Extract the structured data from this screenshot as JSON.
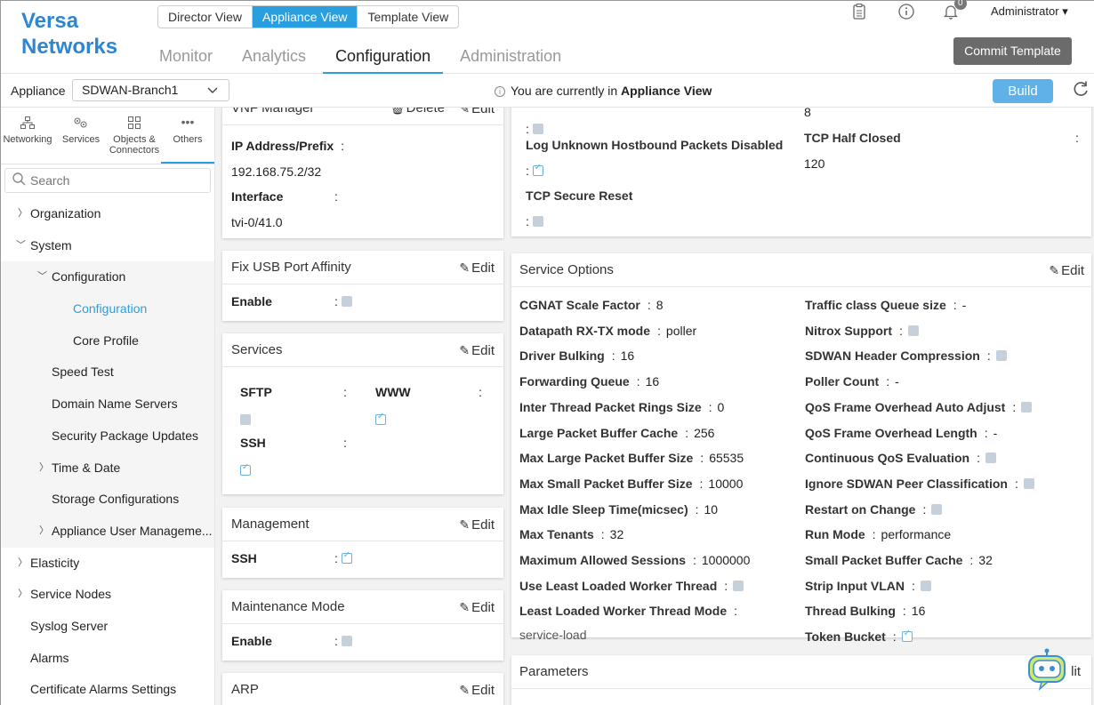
{
  "header": {
    "logo_line1": "Versa",
    "logo_line2": "Networks",
    "view_switch": [
      "Director View",
      "Appliance View",
      "Template View"
    ],
    "tabs": [
      "Monitor",
      "Analytics",
      "Configuration",
      "Administration"
    ],
    "notification_count": "0",
    "user": "Administrator",
    "commit_button": "Commit Template"
  },
  "subbar": {
    "appliance_label": "Appliance",
    "appliance_value": "SDWAN-Branch1",
    "current_view_prefix": "You are currently in",
    "current_view_value": "Appliance View",
    "build_button": "Build"
  },
  "sidebar": {
    "categories": [
      "Networking",
      "Services",
      "Objects &",
      "Connectors",
      "Others"
    ],
    "search_placeholder": "Search",
    "items": [
      "Organization",
      "System",
      "Configuration",
      "Configuration",
      "Core Profile",
      "Speed Test",
      "Domain Name Servers",
      "Security Package Updates",
      "Time & Date",
      "Storage Configurations",
      "Appliance User Manageme...",
      "Elasticity",
      "Service Nodes",
      "Syslog Server",
      "Alarms",
      "Certificate Alarms Settings"
    ]
  },
  "mid": {
    "edit": "Edit",
    "delete": "Delete",
    "vnf": {
      "title": "VNF Manager",
      "ip_label": "IP Address/Prefix",
      "ip_value": "192.168.75.2/32",
      "iface_label": "Interface",
      "iface_value": "tvi-0/41.0"
    },
    "usb": {
      "title": "Fix USB Port Affinity",
      "enable_label": "Enable"
    },
    "services": {
      "title": "Services",
      "sftp": "SFTP",
      "www": "WWW",
      "ssh": "SSH"
    },
    "management": {
      "title": "Management",
      "ssh": "SSH"
    },
    "maintenance": {
      "title": "Maintenance Mode",
      "enable_label": "Enable"
    },
    "arp": {
      "title": "ARP"
    }
  },
  "right": {
    "top": {
      "log_unknown": "Log Unknown Hostbound Packets Disabled",
      "tcp_secure_reset": "TCP Secure Reset",
      "val_8": "8",
      "tcp_half_closed": "TCP Half Closed",
      "val_120": "120"
    },
    "service_options": {
      "title": "Service Options",
      "left": [
        {
          "k": "CGNAT Scale Factor",
          "v": "8"
        },
        {
          "k": "Datapath RX-TX mode",
          "v": "poller"
        },
        {
          "k": "Driver Bulking",
          "v": "16"
        },
        {
          "k": "Forwarding Queue",
          "v": "16"
        },
        {
          "k": "Inter Thread Packet Rings Size",
          "v": "0"
        },
        {
          "k": "Large Packet Buffer Cache",
          "v": "256"
        },
        {
          "k": "Max Large Packet Buffer Size",
          "v": "65535"
        },
        {
          "k": "Max Small Packet Buffer Size",
          "v": "10000"
        },
        {
          "k": "Max Idle Sleep Time(micsec)",
          "v": "10"
        },
        {
          "k": "Max Tenants",
          "v": "32"
        },
        {
          "k": "Maximum Allowed Sessions",
          "v": "1000000"
        },
        {
          "k": "Use Least Loaded Worker Thread",
          "v": ""
        },
        {
          "k": "Least Loaded Worker Thread Mode",
          "v": ""
        }
      ],
      "least_loaded_mode_value": "service-load",
      "right": [
        {
          "k": "Traffic class Queue size",
          "v": "-"
        },
        {
          "k": "Nitrox Support",
          "v": ""
        },
        {
          "k": "SDWAN Header Compression",
          "v": ""
        },
        {
          "k": "Poller Count",
          "v": "-"
        },
        {
          "k": "QoS Frame Overhead Auto Adjust",
          "v": ""
        },
        {
          "k": "QoS Frame Overhead Length",
          "v": "-"
        },
        {
          "k": "Continuous QoS Evaluation",
          "v": ""
        },
        {
          "k": "Ignore SDWAN Peer Classification",
          "v": ""
        },
        {
          "k": "Restart on Change",
          "v": ""
        },
        {
          "k": "Run Mode",
          "v": "performance"
        },
        {
          "k": "Small Packet Buffer Cache",
          "v": "32"
        },
        {
          "k": "Strip Input VLAN",
          "v": ""
        },
        {
          "k": "Thread Bulking",
          "v": "16"
        },
        {
          "k": "Token Bucket",
          "v": ""
        }
      ]
    },
    "parameters": {
      "title": "Parameters",
      "edit_partial": "lit"
    }
  }
}
